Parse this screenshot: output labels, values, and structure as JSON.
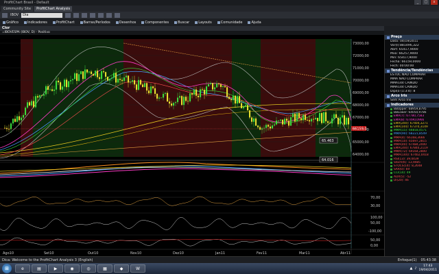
{
  "window": {
    "title": "ProfitChart Brasil - Default",
    "btn_min": "_",
    "btn_max": "□",
    "btn_close": "x"
  },
  "tabs": [
    {
      "label": "Community Site"
    },
    {
      "label": "ProfitChart Analysis"
    }
  ],
  "toolbar": {
    "symbol": "IBOV",
    "period": "Dia"
  },
  "menu": [
    "Gráfico",
    "Indicadores",
    "ProfitChart",
    "Barras/Períodos",
    "Desenhos",
    "Componentes",
    "Buscar",
    "Layouts",
    "Comunidade",
    "Ajuda"
  ],
  "chart": {
    "header": "Clor",
    "subtitle": "=IBOVESPA (IBOV, D) - Positivo",
    "price_labels": [
      "73000,00",
      "72000,00",
      "71000,00",
      "70000,00",
      "69000,00",
      "68000,00",
      "67000,00",
      "66000,00",
      "65000,00",
      "64000,00"
    ],
    "current_price_label": "66159,0",
    "callout_upper": "65.463",
    "callout_lower": "64.016",
    "osc1_labels": [
      "70,00",
      "30,00"
    ],
    "osc2_labels": [
      "100,00",
      "50,00",
      "-100,00"
    ],
    "osc3_labels": [
      "50,00",
      "0,00"
    ],
    "x_labels": [
      "Ago10",
      "Set10",
      "Out10",
      "Nov10",
      "Dez10",
      "Jan11",
      "Fev11",
      "Mar11",
      "Abr11"
    ]
  },
  "chart_data": {
    "type": "candlestick",
    "title": "=IBOVESPA (IBOV, D) - Positivo",
    "categories": [
      "Ago10",
      "Set10",
      "Out10",
      "Nov10",
      "Dez10",
      "Jan11",
      "Fev11",
      "Mar11",
      "Abr11"
    ],
    "close_approx": [
      66500,
      69500,
      71000,
      70000,
      68500,
      70000,
      66500,
      67500,
      67000
    ],
    "last_close": 66159,
    "high": 73000,
    "low": 64016,
    "ylim": [
      64000,
      73500
    ],
    "annotations": [
      "65.463",
      "64.016"
    ]
  },
  "panel": {
    "price_header": "Preço",
    "price_rows": [
      "Data: 04/19/2011",
      "Var(I):881496,322",
      "Abrt: 65417,9000",
      "Mxa: 66257,9000",
      "Min: 65417,9000",
      "Fecha: 66159,0000",
      "Fech: 00:00:00"
    ],
    "trend_header": "Tendência/Tendências",
    "trend_rows": [
      "ESTOC NÃO COMPRAR",
      "MMA NÃO COMPRAR",
      "MMA144 CAINDO",
      "MMA144 CAINDO",
      "Dipi(o (1:3:4): 8"
    ],
    "arc_header": "Arco Iris",
    "arc_rows": [
      "Sem Arco Iris"
    ],
    "ind_header": "Indicadores",
    "indicators": [
      {
        "label": "BBUpper: 68959,8795",
        "color": "#d0d0d0"
      },
      {
        "label": "BBLower: 64050,9786",
        "color": "#d0d0d0"
      },
      {
        "label": "EMA(7): 67780,7583",
        "color": "#ff3cc8"
      },
      {
        "label": "EMA(8): 67490,0966",
        "color": "#ff3cc8"
      },
      {
        "label": "EMA(200): 67404,3271",
        "color": "#e8c820"
      },
      {
        "label": "EMA(144): 67370,3149",
        "color": "#e8c820"
      },
      {
        "label": "MMA(15): 66818,4571",
        "color": "#3ce03c"
      },
      {
        "label": "MMA(90): 68221,8549",
        "color": "#4aa0ff"
      },
      {
        "label": "MMA(4): 66168,3666",
        "color": "#ff5050"
      },
      {
        "label": "MMA(10): 65697,2815",
        "color": "#ff5050"
      },
      {
        "label": "MMA(40): 67484,2000",
        "color": "#ff5050"
      },
      {
        "label": "EMA(200): 67840,2119",
        "color": "#ff5050"
      },
      {
        "label": "MMA(72): 69164,2800",
        "color": "#ff5050"
      },
      {
        "label": "MMA(144): 67402,0418",
        "color": "#ff5050"
      },
      {
        "label": "RSI(13): 39,0439",
        "color": "#ff5050"
      },
      {
        "label": "Stoch(K): 13,9485",
        "color": "#ff5050"
      },
      {
        "label": "STOCS(14): 8,2648",
        "color": "#ff5050"
      },
      {
        "label": "SAR(0): 69",
        "color": "#ff5050"
      },
      {
        "label": "CCI(14): 49",
        "color": "#3ce03c"
      },
      {
        "label": "ADX(5): -52",
        "color": "#ff5050"
      },
      {
        "label": "DI(20): 46",
        "color": "#ff5050"
      }
    ]
  },
  "status": {
    "left": "Dica: Welcome to the ProfitChart Analysis 3 (English)",
    "right1": "Enfoque(1)",
    "right2": "05:43:38"
  },
  "taskbar": {
    "start": "⊞",
    "time": "17:43",
    "date": "19/04/2011"
  }
}
